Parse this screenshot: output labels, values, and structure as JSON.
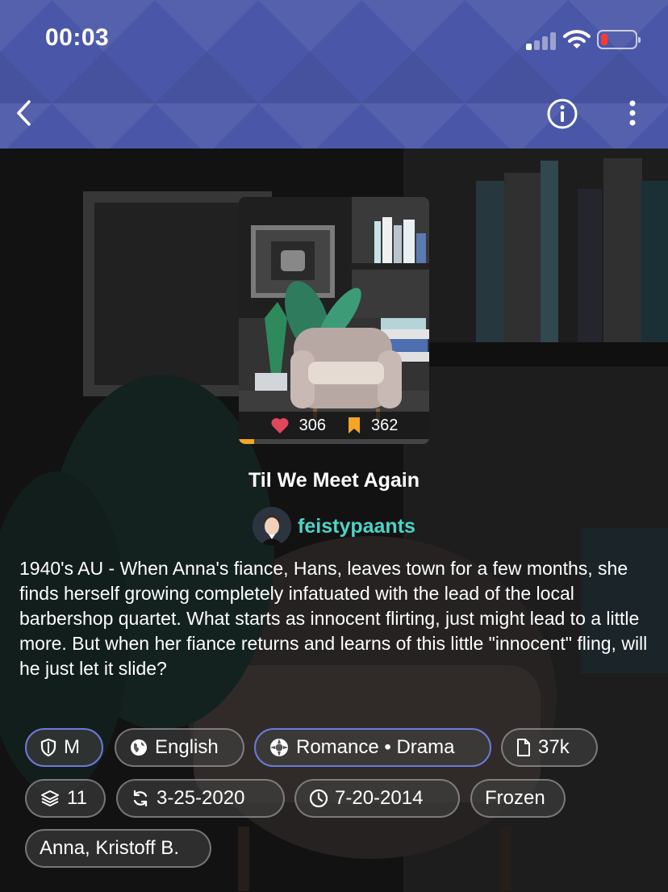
{
  "status_bar": {
    "time": "00:03"
  },
  "header": {
    "back_icon": "chevron-left-icon",
    "info_icon": "info-circle-icon",
    "more_icon": "vertical-ellipsis-icon",
    "background_color": "#4a57a8"
  },
  "story": {
    "title": "Til We Meet Again",
    "likes": "306",
    "bookmarks": "362",
    "author": "feistypaants",
    "description": "1940's AU - When Anna's fiance, Hans, leaves town for a few months, she finds herself growing completely infatuated with the lead of the local barbershop quartet. What starts as innocent flirting, just might lead to a little more. But when her fiance returns and learns of this little \"innocent\" fling, will he just let it slide?"
  },
  "tags": [
    {
      "icon": "shield-icon",
      "label": "M"
    },
    {
      "icon": "globe-icon",
      "label": "English"
    },
    {
      "icon": "genre-icon",
      "label": "Romance • Drama"
    },
    {
      "icon": "document-icon",
      "label": "37k"
    },
    {
      "icon": "layers-icon",
      "label": "11"
    },
    {
      "icon": "refresh-icon",
      "label": "3-25-2020"
    },
    {
      "icon": "clock-icon",
      "label": "7-20-2014"
    },
    {
      "icon": "",
      "label": "Frozen"
    },
    {
      "icon": "",
      "label": "Anna, Kristoff B."
    }
  ],
  "colors": {
    "accent": "#4fd3c4",
    "like": "#e0475b",
    "bookmark": "#f5a623",
    "tag_highlight_border": "#6c7ad8"
  },
  "reading_progress": 0.08
}
